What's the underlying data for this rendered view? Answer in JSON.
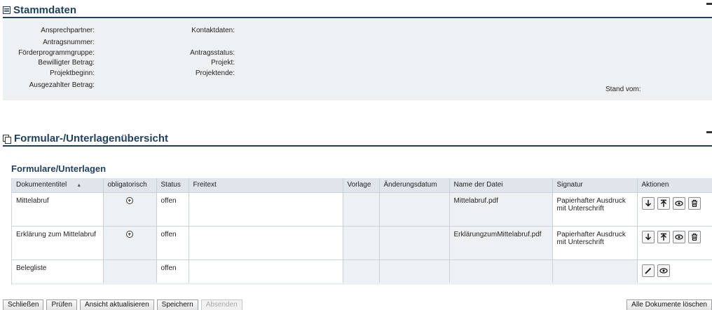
{
  "stammdaten": {
    "title": "Stammdaten",
    "left_labels": [
      "Ansprechpartner:",
      "Antragsnummer:",
      "Förderprogrammgruppe:",
      "Bewilligter Betrag:",
      "Projektbeginn:",
      "Ausgezahlter Betrag:"
    ],
    "right_labels": [
      "Kontaktdaten:",
      "Antragsstatus:",
      "Projekt:",
      "Projektende:"
    ],
    "stand_vom": "Stand vom:"
  },
  "uebersicht": {
    "title": "Formular-/Unterlagenübersicht",
    "subtitle": "Formulare/Unterlagen",
    "columns": [
      "Dokumententitel",
      "obligatorisch",
      "Status",
      "Freitext",
      "Vorlage",
      "Änderungsdatum",
      "Name der Datei",
      "Signatur",
      "Aktionen"
    ],
    "sort_indicator": "▲",
    "rows": [
      {
        "title": "Mittelabruf",
        "obligatorisch": true,
        "status": "offen",
        "freitext": "",
        "vorlage": "",
        "aenderungsdatum": "",
        "datei": "Mittelabruf.pdf",
        "signatur": "Papierhafter Ausdruck mit Unterschrift",
        "actions": [
          "download-icon",
          "upload-icon",
          "view-icon",
          "delete-icon"
        ]
      },
      {
        "title": "Erklärung zum Mittelabruf",
        "obligatorisch": true,
        "status": "offen",
        "freitext": "",
        "vorlage": "",
        "aenderungsdatum": "",
        "datei": "ErklärungzumMittelabruf.pdf",
        "signatur": "Papierhafter Ausdruck mit Unterschrift",
        "actions": [
          "download-icon",
          "upload-icon",
          "view-icon",
          "delete-icon"
        ]
      },
      {
        "title": "Belegliste",
        "obligatorisch": false,
        "status": "offen",
        "freitext": "",
        "vorlage": "",
        "aenderungsdatum": "",
        "datei": "",
        "signatur": "",
        "actions": [
          "edit-icon",
          "view-icon"
        ]
      }
    ]
  },
  "buttons": {
    "schliessen": "Schließen",
    "pruefen": "Prüfen",
    "ansicht": "Ansicht aktualisieren",
    "speichern": "Speichern",
    "absenden": "Absenden",
    "alle_loeschen": "Alle Dokumente löschen"
  }
}
